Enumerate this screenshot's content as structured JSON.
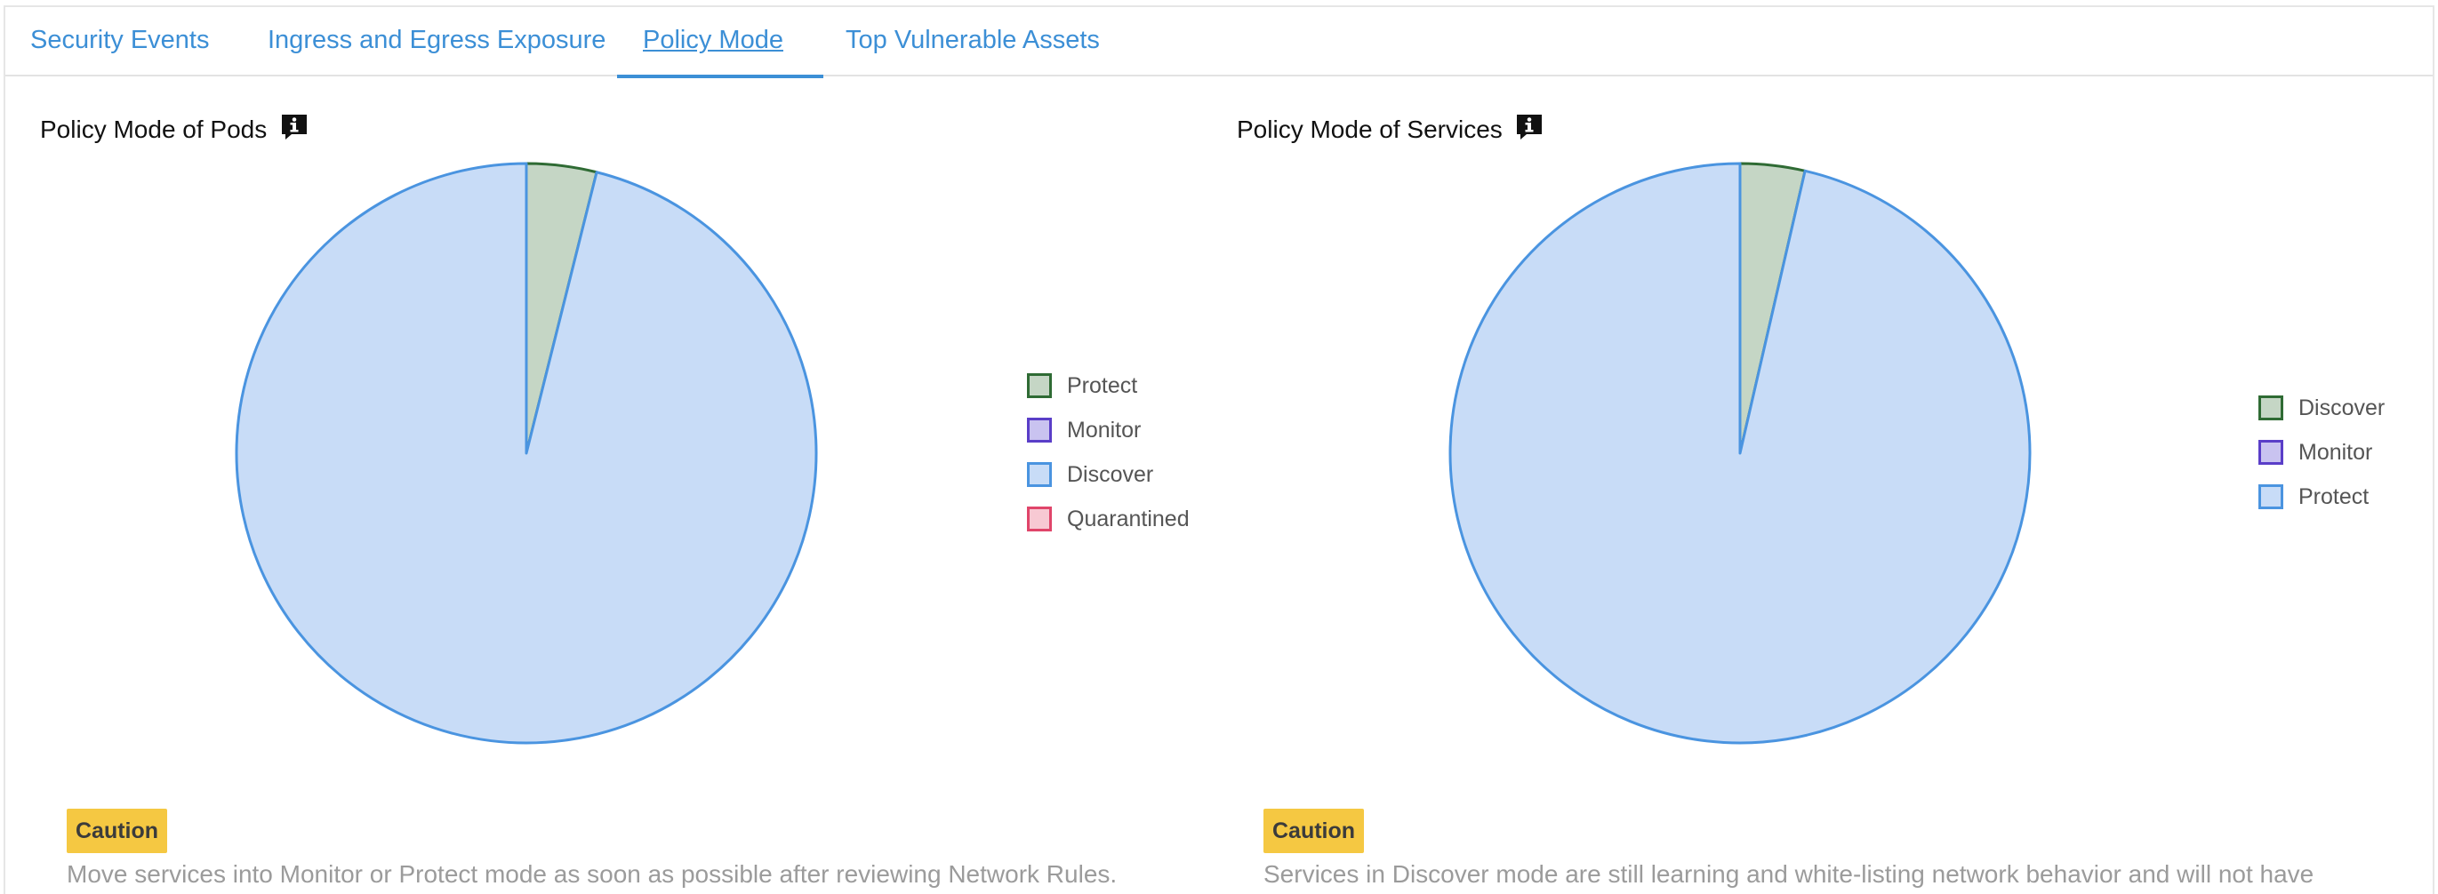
{
  "tabs": [
    {
      "label": "Security Events"
    },
    {
      "label": "Ingress and Egress Exposure"
    },
    {
      "label": "Policy Mode",
      "active": true
    },
    {
      "label": "Top Vulnerable Assets"
    }
  ],
  "panels": [
    {
      "title": "Policy Mode of Pods",
      "info_icon": "info-icon",
      "caution_label": "Caution",
      "caution_text": "Move services into Monitor or Protect mode as soon as possible after reviewing Network Rules."
    },
    {
      "title": "Policy Mode of Services",
      "info_icon": "info-icon",
      "caution_label": "Caution",
      "caution_text": "Services in Discover mode are still learning and white-listing network behavior and will not have"
    }
  ],
  "chart_data": [
    {
      "type": "pie",
      "title": "Policy Mode of Pods",
      "categories": [
        "Protect",
        "Monitor",
        "Discover",
        "Quarantined"
      ],
      "values": [
        3.9,
        0,
        96.1,
        0
      ],
      "colors": {
        "Protect": {
          "fill": "#c5d6c5",
          "stroke": "#2f6b34"
        },
        "Monitor": {
          "fill": "#c9c3f0",
          "stroke": "#5a3ec8"
        },
        "Discover": {
          "fill": "#c8dcf7",
          "stroke": "#4a94e0"
        },
        "Quarantined": {
          "fill": "#f7c9d3",
          "stroke": "#e0456a"
        }
      },
      "legend_position": "right"
    },
    {
      "type": "pie",
      "title": "Policy Mode of Services",
      "categories": [
        "Discover",
        "Monitor",
        "Protect"
      ],
      "values": [
        3.6,
        0,
        96.4
      ],
      "colors": {
        "Discover": {
          "fill": "#c5d6c5",
          "stroke": "#2f6b34"
        },
        "Monitor": {
          "fill": "#c9c3f0",
          "stroke": "#5a3ec8"
        },
        "Protect": {
          "fill": "#c8dcf7",
          "stroke": "#4a94e0"
        }
      },
      "legend_position": "right"
    }
  ]
}
